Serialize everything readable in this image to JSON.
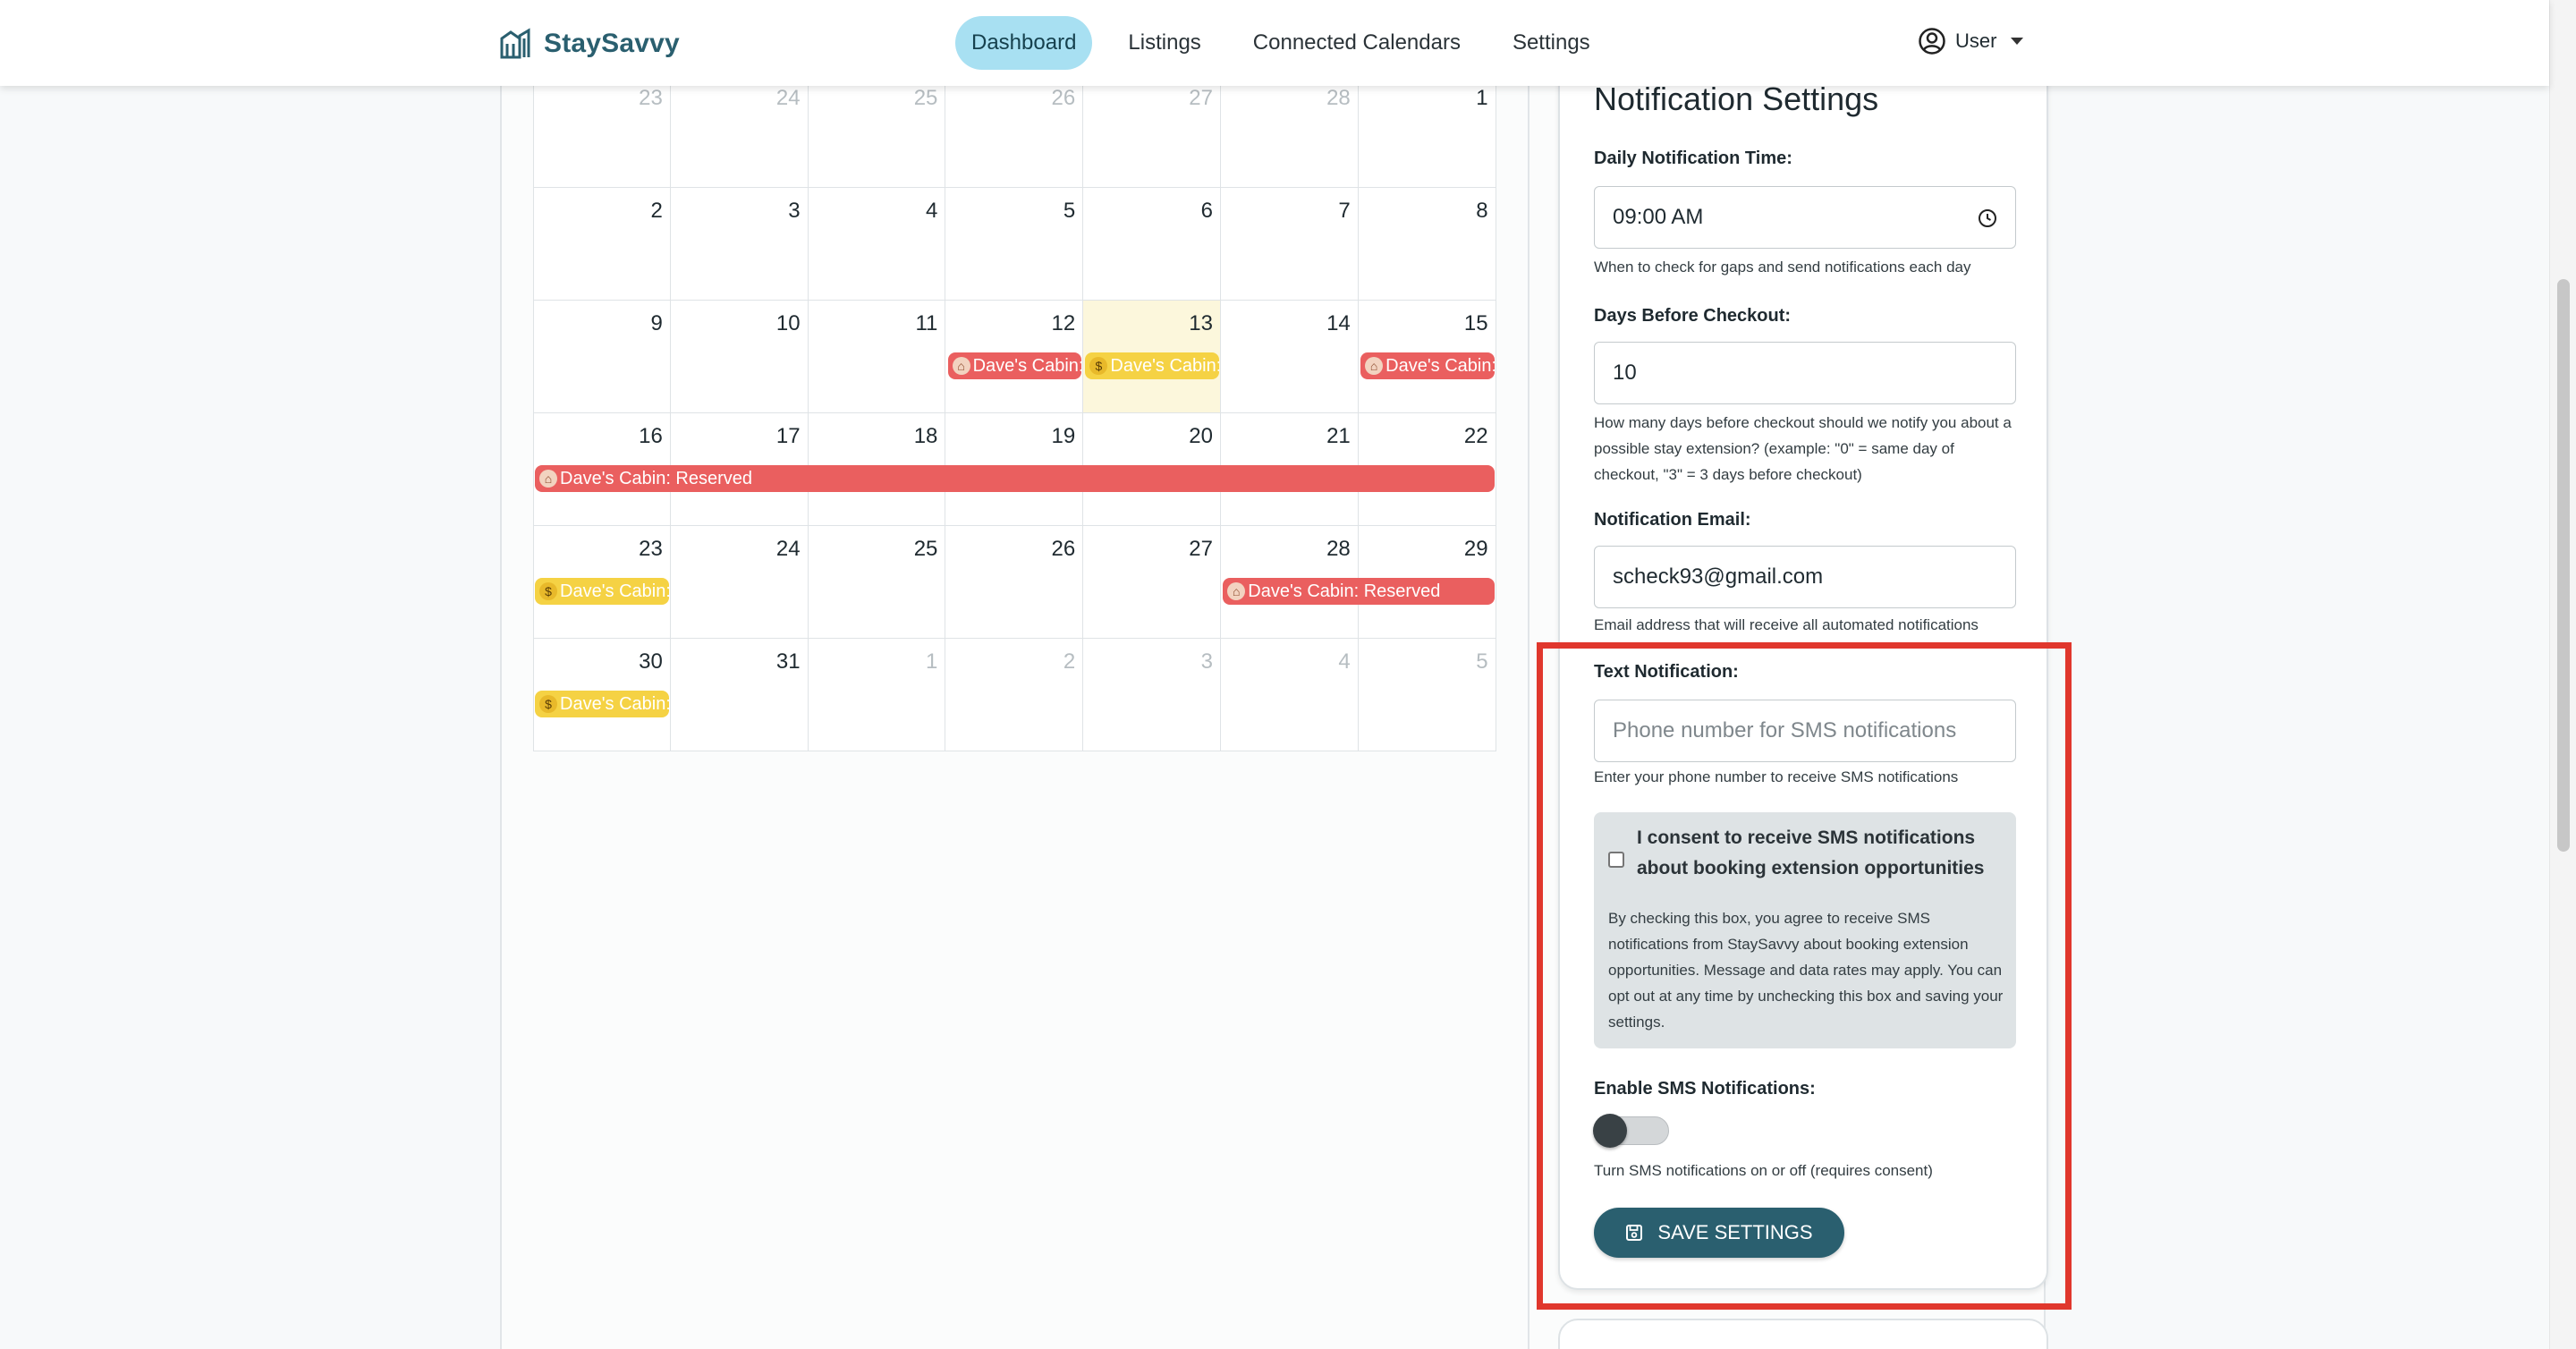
{
  "app": {
    "name": "StaySavvy"
  },
  "nav": {
    "items": [
      {
        "label": "Dashboard",
        "active": true
      },
      {
        "label": "Listings",
        "active": false
      },
      {
        "label": "Connected Calendars",
        "active": false
      },
      {
        "label": "Settings",
        "active": false
      }
    ],
    "user_label": "User"
  },
  "calendar": {
    "weeks": [
      [
        {
          "d": "23",
          "m": true
        },
        {
          "d": "24",
          "m": true
        },
        {
          "d": "25",
          "m": true
        },
        {
          "d": "26",
          "m": true
        },
        {
          "d": "27",
          "m": true
        },
        {
          "d": "28",
          "m": true
        },
        {
          "d": "1",
          "m": false
        }
      ],
      [
        {
          "d": "2",
          "m": false
        },
        {
          "d": "3",
          "m": false
        },
        {
          "d": "4",
          "m": false
        },
        {
          "d": "5",
          "m": false
        },
        {
          "d": "6",
          "m": false
        },
        {
          "d": "7",
          "m": false
        },
        {
          "d": "8",
          "m": false
        }
      ],
      [
        {
          "d": "9",
          "m": false
        },
        {
          "d": "10",
          "m": false
        },
        {
          "d": "11",
          "m": false
        },
        {
          "d": "12",
          "m": false
        },
        {
          "d": "13",
          "m": false,
          "today": true
        },
        {
          "d": "14",
          "m": false
        },
        {
          "d": "15",
          "m": false
        }
      ],
      [
        {
          "d": "16",
          "m": false
        },
        {
          "d": "17",
          "m": false
        },
        {
          "d": "18",
          "m": false
        },
        {
          "d": "19",
          "m": false
        },
        {
          "d": "20",
          "m": false
        },
        {
          "d": "21",
          "m": false
        },
        {
          "d": "22",
          "m": false
        }
      ],
      [
        {
          "d": "23",
          "m": false
        },
        {
          "d": "24",
          "m": false
        },
        {
          "d": "25",
          "m": false
        },
        {
          "d": "26",
          "m": false
        },
        {
          "d": "27",
          "m": false
        },
        {
          "d": "28",
          "m": false
        },
        {
          "d": "29",
          "m": false
        }
      ],
      [
        {
          "d": "30",
          "m": false
        },
        {
          "d": "31",
          "m": false
        },
        {
          "d": "1",
          "m": true
        },
        {
          "d": "2",
          "m": true
        },
        {
          "d": "3",
          "m": true
        },
        {
          "d": "4",
          "m": true
        },
        {
          "d": "5",
          "m": true
        }
      ]
    ],
    "events": [
      {
        "week": 2,
        "start": 3,
        "span": 1,
        "color": "red",
        "label": "Dave's Cabin:",
        "icon": "house-icon"
      },
      {
        "week": 2,
        "start": 4,
        "span": 1,
        "color": "yellow",
        "label": "Dave's Cabin:",
        "icon": "money-bag-icon"
      },
      {
        "week": 2,
        "start": 6,
        "span": 1,
        "color": "red",
        "label": "Dave's Cabin:",
        "icon": "house-icon"
      },
      {
        "week": 3,
        "start": 0,
        "span": 7,
        "color": "red",
        "label": "Dave's Cabin: Reserved",
        "icon": "house-icon"
      },
      {
        "week": 4,
        "start": 0,
        "span": 1,
        "color": "yellow",
        "label": "Dave's Cabin:",
        "icon": "money-bag-icon"
      },
      {
        "week": 4,
        "start": 5,
        "span": 2,
        "color": "red",
        "label": "Dave's Cabin: Reserved",
        "icon": "house-icon"
      },
      {
        "week": 5,
        "start": 0,
        "span": 1,
        "color": "yellow",
        "label": "Dave's Cabin:",
        "icon": "money-bag-icon"
      }
    ]
  },
  "settings": {
    "title": "Notification Settings",
    "daily_time": {
      "label": "Daily Notification Time:",
      "value": "09:00 AM",
      "help": "When to check for gaps and send notifications each day"
    },
    "days_before": {
      "label": "Days Before Checkout:",
      "value": "10",
      "help": "How many days before checkout should we notify you about a possible stay extension? (example: \"0\" = same day of checkout, \"3\" = 3 days before checkout)"
    },
    "email": {
      "label": "Notification Email:",
      "value": "scheck93@gmail.com",
      "help": "Email address that will receive all automated notifications"
    },
    "text": {
      "label": "Text Notification:",
      "placeholder": "Phone number for SMS notifications",
      "help": "Enter your phone number to receive SMS notifications"
    },
    "consent": {
      "label": "I consent to receive SMS notifications about booking extension opportunities",
      "checked": false,
      "body": "By checking this box, you agree to receive SMS notifications from StaySavvy about booking extension opportunities. Message and data rates may apply. You can opt out at any time by unchecking this box and saving your settings."
    },
    "sms_toggle": {
      "label": "Enable SMS Notifications:",
      "enabled": false,
      "help": "Turn SMS notifications on or off (requires consent)"
    },
    "save_label": "SAVE SETTINGS"
  },
  "colors": {
    "brand": "#2a5f6f",
    "active_nav": "#a8e0f2",
    "reserved": "#ea5f5f",
    "gap": "#f5d244",
    "highlight": "#e0372d"
  }
}
